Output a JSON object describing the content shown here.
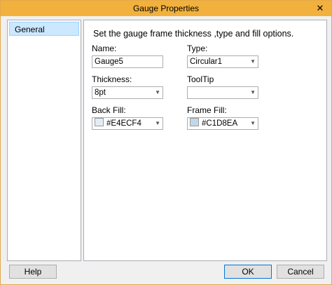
{
  "window": {
    "title": "Gauge Properties",
    "close_glyph": "✕"
  },
  "sidebar": {
    "items": [
      {
        "label": "General"
      }
    ]
  },
  "content": {
    "description": "Set the gauge frame thickness ,type and fill options.",
    "name": {
      "label": "Name:",
      "value": "Gauge5"
    },
    "type": {
      "label": "Type:",
      "value": "Circular1"
    },
    "thickness": {
      "label": "Thickness:",
      "value": "8pt"
    },
    "tooltip": {
      "label": "ToolTip",
      "value": ""
    },
    "back_fill": {
      "label": "Back Fill:",
      "value": "#E4ECF4",
      "color": "#E4ECF4"
    },
    "frame_fill": {
      "label": "Frame Fill:",
      "value": "#C1D8EA",
      "color": "#C1D8EA"
    }
  },
  "footer": {
    "help_label": "Help",
    "ok_label": "OK",
    "cancel_label": "Cancel"
  },
  "icons": {
    "dropdown": "chevron-down-icon",
    "close": "close-icon"
  }
}
